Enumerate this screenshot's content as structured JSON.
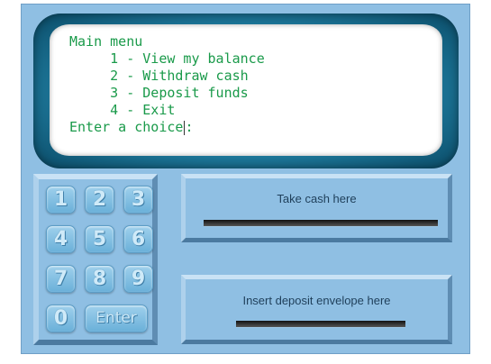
{
  "screen": {
    "lines": [
      "Main menu",
      "     1 - View my balance",
      "     2 - Withdraw cash",
      "     3 - Deposit funds",
      "     4 - Exit",
      "Enter a choice"
    ],
    "prompt_suffix": ":"
  },
  "keypad": {
    "keys": [
      "1",
      "2",
      "3",
      "4",
      "5",
      "6",
      "7",
      "8",
      "9",
      "0",
      "Enter"
    ]
  },
  "cash_dispenser": {
    "label": "Take cash here"
  },
  "deposit_slot": {
    "label": "Insert deposit envelope here"
  }
}
